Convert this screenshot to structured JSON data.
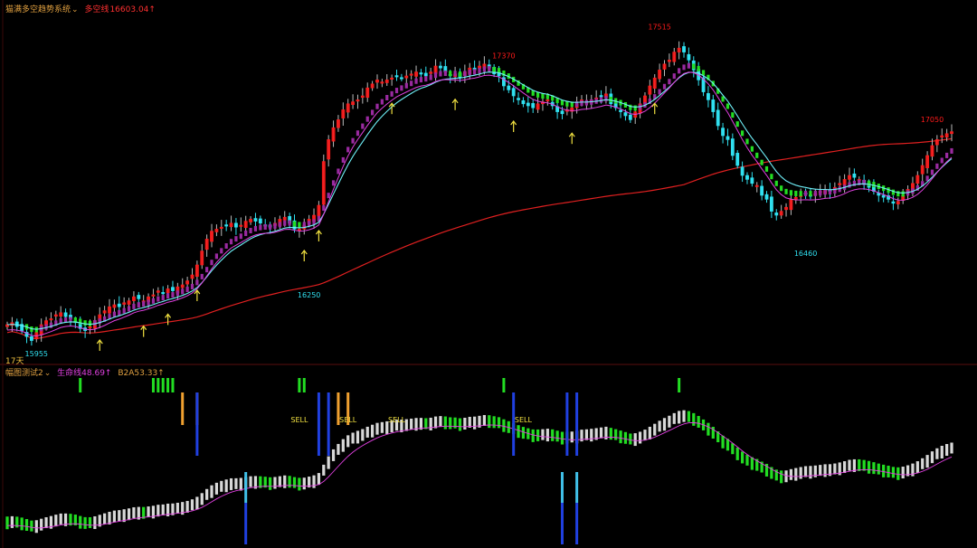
{
  "header": {
    "title": "猫满多空趋势系统",
    "dropdown": "⌄",
    "ma_label": "多空线",
    "ma_value": "16603.04↑"
  },
  "period_label": "17天",
  "sub_header": {
    "title": "幅图测试2",
    "dropdown": "⌄",
    "life_label": "生命线",
    "life_value": "48.69↑",
    "b2a_label": "B2A",
    "b2a_value": "53.33↑"
  },
  "colors": {
    "background": "#000000",
    "up_red": "#ff1a1a",
    "down_cyan": "#30e0f0",
    "trend_green": "#22dd22",
    "trend_purple": "#9a2aa0",
    "ma_cyan": "#6ff0f8",
    "ma_magenta": "#e040e0",
    "ma_red": "#e02020",
    "arrow_yellow": "#f0e040",
    "bar_white": "#d8d8d8",
    "signal_orange": "#f0a030",
    "signal_blue": "#2040e0",
    "signal_skyblue": "#40c0e8",
    "header_text": "#e0a040",
    "header_red": "#ff3030",
    "header_magenta": "#e040e0"
  },
  "chart_data": [
    {
      "type": "candlestick",
      "title": "猫满多空趋势系统",
      "ylim": [
        15900,
        17600
      ],
      "price_labels": [
        {
          "x": 6,
          "text": "15955"
        },
        {
          "x": 62,
          "text": "16250"
        },
        {
          "x": 102,
          "text": "17370"
        },
        {
          "x": 134,
          "text": "17515"
        },
        {
          "x": 164,
          "text": "16460"
        },
        {
          "x": 190,
          "text": "17050"
        }
      ],
      "arrows_x": [
        19,
        28,
        33,
        39,
        61,
        64,
        79,
        92,
        104,
        116,
        133
      ],
      "close": [
        16050,
        16060,
        16040,
        16020,
        15990,
        15970,
        16010,
        16050,
        16070,
        16080,
        16100,
        16110,
        16090,
        16080,
        16060,
        16030,
        16020,
        16040,
        16070,
        16100,
        16120,
        16140,
        16150,
        16140,
        16160,
        16170,
        16190,
        16180,
        16170,
        16190,
        16200,
        16220,
        16210,
        16230,
        16220,
        16240,
        16250,
        16270,
        16300,
        16350,
        16420,
        16480,
        16520,
        16530,
        16540,
        16550,
        16560,
        16540,
        16550,
        16570,
        16580,
        16570,
        16560,
        16550,
        16540,
        16560,
        16580,
        16590,
        16560,
        16530,
        16530,
        16550,
        16580,
        16600,
        16650,
        16870,
        16980,
        17040,
        17080,
        17130,
        17160,
        17170,
        17180,
        17200,
        17240,
        17260,
        17280,
        17270,
        17280,
        17290,
        17300,
        17290,
        17300,
        17310,
        17320,
        17310,
        17300,
        17320,
        17350,
        17340,
        17320,
        17300,
        17310,
        17290,
        17320,
        17340,
        17330,
        17350,
        17360,
        17340,
        17310,
        17300,
        17250,
        17230,
        17200,
        17180,
        17160,
        17150,
        17140,
        17160,
        17170,
        17180,
        17150,
        17120,
        17110,
        17130,
        17140,
        17160,
        17180,
        17170,
        17180,
        17190,
        17200,
        17210,
        17160,
        17140,
        17120,
        17100,
        17080,
        17120,
        17160,
        17200,
        17250,
        17290,
        17330,
        17360,
        17380,
        17420,
        17440,
        17420,
        17380,
        17330,
        17280,
        17220,
        17180,
        17120,
        17050,
        17000,
        16980,
        16900,
        16850,
        16800,
        16780,
        16760,
        16750,
        16700,
        16680,
        16620,
        16600,
        16620,
        16640,
        16680,
        16690,
        16700,
        16710,
        16700,
        16710,
        16720,
        16730,
        16720,
        16740,
        16760,
        16780,
        16800,
        16790,
        16780,
        16760,
        16740,
        16720,
        16700,
        16690,
        16680,
        16660,
        16670,
        16700,
        16730,
        16760,
        16800,
        16850,
        16900,
        16950,
        16980,
        17000,
        17010,
        17020
      ]
    },
    {
      "type": "bar",
      "title": "幅图测试2",
      "ylim": [
        0,
        100
      ],
      "sell_labels": [
        {
          "x": 60,
          "text": "SELL"
        },
        {
          "x": 70,
          "text": "SELL"
        },
        {
          "x": 80,
          "text": "SELL"
        },
        {
          "x": 106,
          "text": "SELL"
        }
      ],
      "orange_x": [
        36,
        39,
        68,
        70
      ],
      "blue_x": [
        39,
        64,
        66,
        104,
        115,
        117
      ],
      "skyblue_x": [
        49,
        114,
        117
      ],
      "green_top_x": [
        15,
        30,
        31,
        32,
        33,
        34,
        60,
        61,
        102,
        138
      ]
    }
  ]
}
